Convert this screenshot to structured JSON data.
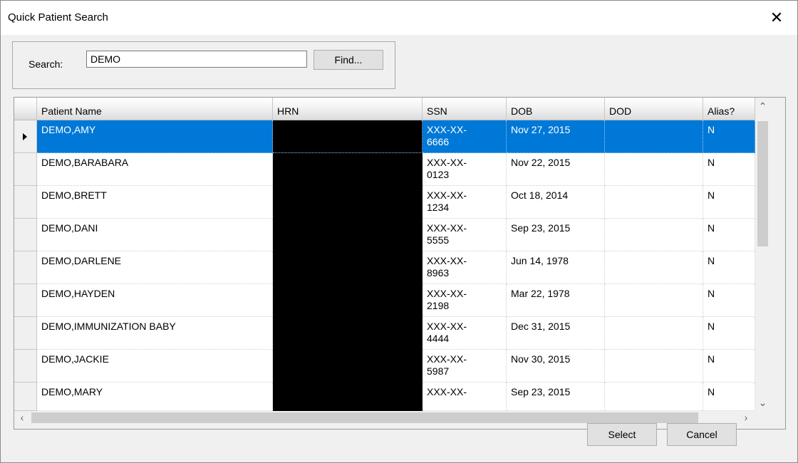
{
  "window": {
    "title": "Quick Patient Search",
    "close_glyph": "✕"
  },
  "search": {
    "label": "Search:",
    "value": "DEMO",
    "find_label": "Find..."
  },
  "grid": {
    "columns": [
      "Patient Name",
      "HRN",
      "SSN",
      "DOB",
      "DOD",
      "Alias?"
    ],
    "rows": [
      {
        "name": "DEMO,AMY",
        "hrn": "",
        "ssn": "XXX-XX-\n6666",
        "dob": "Nov 27, 2015",
        "dod": "",
        "alias": "N"
      },
      {
        "name": "DEMO,BARABARA",
        "hrn": "",
        "ssn": "XXX-XX-\n0123",
        "dob": "Nov 22, 2015",
        "dod": "",
        "alias": "N"
      },
      {
        "name": "DEMO,BRETT",
        "hrn": "",
        "ssn": "XXX-XX-\n1234",
        "dob": "Oct 18, 2014",
        "dod": "",
        "alias": "N"
      },
      {
        "name": "DEMO,DANI",
        "hrn": "",
        "ssn": "XXX-XX-\n5555",
        "dob": "Sep 23, 2015",
        "dod": "",
        "alias": "N"
      },
      {
        "name": "DEMO,DARLENE",
        "hrn": "",
        "ssn": "XXX-XX-\n8963",
        "dob": "Jun 14, 1978",
        "dod": "",
        "alias": "N"
      },
      {
        "name": "DEMO,HAYDEN",
        "hrn": "",
        "ssn": "XXX-XX-\n2198",
        "dob": "Mar 22, 1978",
        "dod": "",
        "alias": "N"
      },
      {
        "name": "DEMO,IMMUNIZATION BABY",
        "hrn": "",
        "ssn": "XXX-XX-\n4444",
        "dob": "Dec 31, 2015",
        "dod": "",
        "alias": "N"
      },
      {
        "name": "DEMO,JACKIE",
        "hrn": "",
        "ssn": "XXX-XX-\n5987",
        "dob": "Nov 30, 2015",
        "dod": "",
        "alias": "N"
      },
      {
        "name": "DEMO,MARY",
        "hrn": "",
        "ssn": "XXX-XX-",
        "dob": "Sep 23, 2015",
        "dod": "",
        "alias": "N"
      }
    ],
    "selected_row": "DEMO,AMY",
    "selection_color": "#0078d7",
    "redaction_color": "#000000"
  },
  "scrollbars": {
    "up": "⌃",
    "down": "⌄",
    "left": "‹",
    "right": "›"
  },
  "buttons": {
    "select_label": "Select",
    "cancel_label": "Cancel"
  }
}
